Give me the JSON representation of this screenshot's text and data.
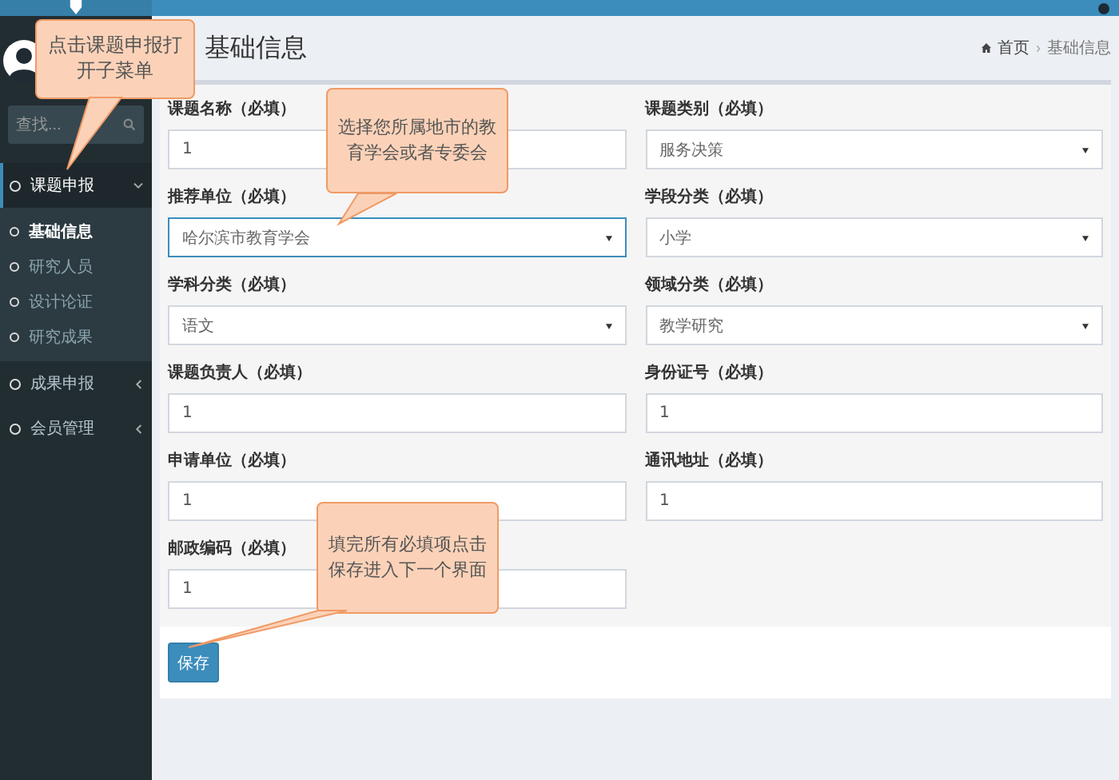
{
  "sidebar": {
    "search": {
      "placeholder": "查找..."
    },
    "menu": [
      {
        "label": "课题申报",
        "expanded": true,
        "children": [
          {
            "label": "基础信息",
            "selected": true
          },
          {
            "label": "研究人员",
            "selected": false
          },
          {
            "label": "设计论证",
            "selected": false
          },
          {
            "label": "研究成果",
            "selected": false
          }
        ]
      },
      {
        "label": "成果申报",
        "expanded": false
      },
      {
        "label": "会员管理",
        "expanded": false
      }
    ]
  },
  "page": {
    "title": "基础信息",
    "breadcrumb": [
      "首页",
      "基础信息"
    ]
  },
  "form": {
    "rows": [
      [
        {
          "label": "课题名称（必填）",
          "kind": "text",
          "value": "1"
        },
        {
          "label": "课题类别（必填）",
          "kind": "select",
          "value": "服务决策"
        }
      ],
      [
        {
          "label": "推荐单位（必填）",
          "kind": "select",
          "value": "哈尔滨市教育学会",
          "focused": true
        },
        {
          "label": "学段分类（必填）",
          "kind": "select",
          "value": "小学"
        }
      ],
      [
        {
          "label": "学科分类（必填）",
          "kind": "select",
          "value": "语文"
        },
        {
          "label": "领域分类（必填）",
          "kind": "select",
          "value": "教学研究"
        }
      ],
      [
        {
          "label": "课题负责人（必填）",
          "kind": "text",
          "value": "1"
        },
        {
          "label": "身份证号（必填）",
          "kind": "text",
          "value": "1"
        }
      ],
      [
        {
          "label": "申请单位（必填）",
          "kind": "text",
          "value": "1"
        },
        {
          "label": "通讯地址（必填）",
          "kind": "text",
          "value": "1"
        }
      ],
      [
        {
          "label": "邮政编码（必填）",
          "kind": "text",
          "value": "1"
        }
      ]
    ],
    "save_button": "保存"
  },
  "callouts": [
    "点击课题申报打开子菜单",
    "选择您所属地市的教育学会或者专委会",
    "填完所有必填项点击保存进入下一个界面"
  ]
}
